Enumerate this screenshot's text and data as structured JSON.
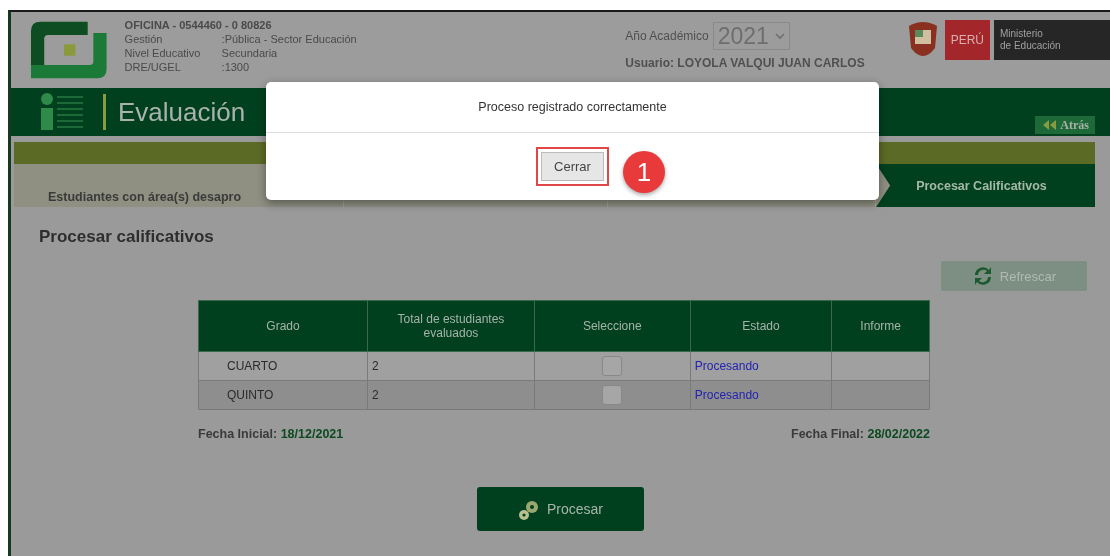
{
  "header": {
    "office": "OFICINA - 0544460 - 0  80826",
    "fields": [
      {
        "label": "Gestión",
        "value": ":Pública - Sector Educación"
      },
      {
        "label": "Nivel Educativo",
        "value": "Secundaria"
      },
      {
        "label": "DRE/UGEL",
        "value": ":1300"
      }
    ],
    "year_label": "Año Académico",
    "year": "2021",
    "user": "Usuario: LOYOLA VALQUI JUAN CARLOS",
    "brand": {
      "country": "PERÚ",
      "ministry": [
        "Ministerio",
        "de Educación"
      ]
    }
  },
  "title_bar": {
    "title": "Evaluación",
    "back": "Atrás"
  },
  "steps": [
    {
      "label": "Estudiantes con área(s) desapro",
      "selected": false
    },
    {
      "selected": false
    },
    {
      "selected": false
    },
    {
      "label": "Procesar Calificativos",
      "selected": true
    }
  ],
  "section_title": "Procesar calificativos",
  "refresh": "Refrescar",
  "table": {
    "columns": [
      "Grado",
      "Total de estudiantes evaluados",
      "Seleccione",
      "Estado",
      "Informe"
    ],
    "rows": [
      {
        "grade": "CUARTO",
        "total": "2",
        "checked": false,
        "status": "Procesando"
      },
      {
        "grade": "QUINTO",
        "total": "2",
        "checked": false,
        "status": "Procesando"
      }
    ]
  },
  "dates": [
    {
      "label": "Fecha Inicial:",
      "value": "18/12/2021"
    },
    {
      "label": "Fecha Final:",
      "value": "28/02/2022"
    }
  ],
  "process_button": "Procesar",
  "dialog": {
    "message": "Proceso registrado correctamente",
    "button": "Cerrar",
    "step_badge": "1"
  }
}
